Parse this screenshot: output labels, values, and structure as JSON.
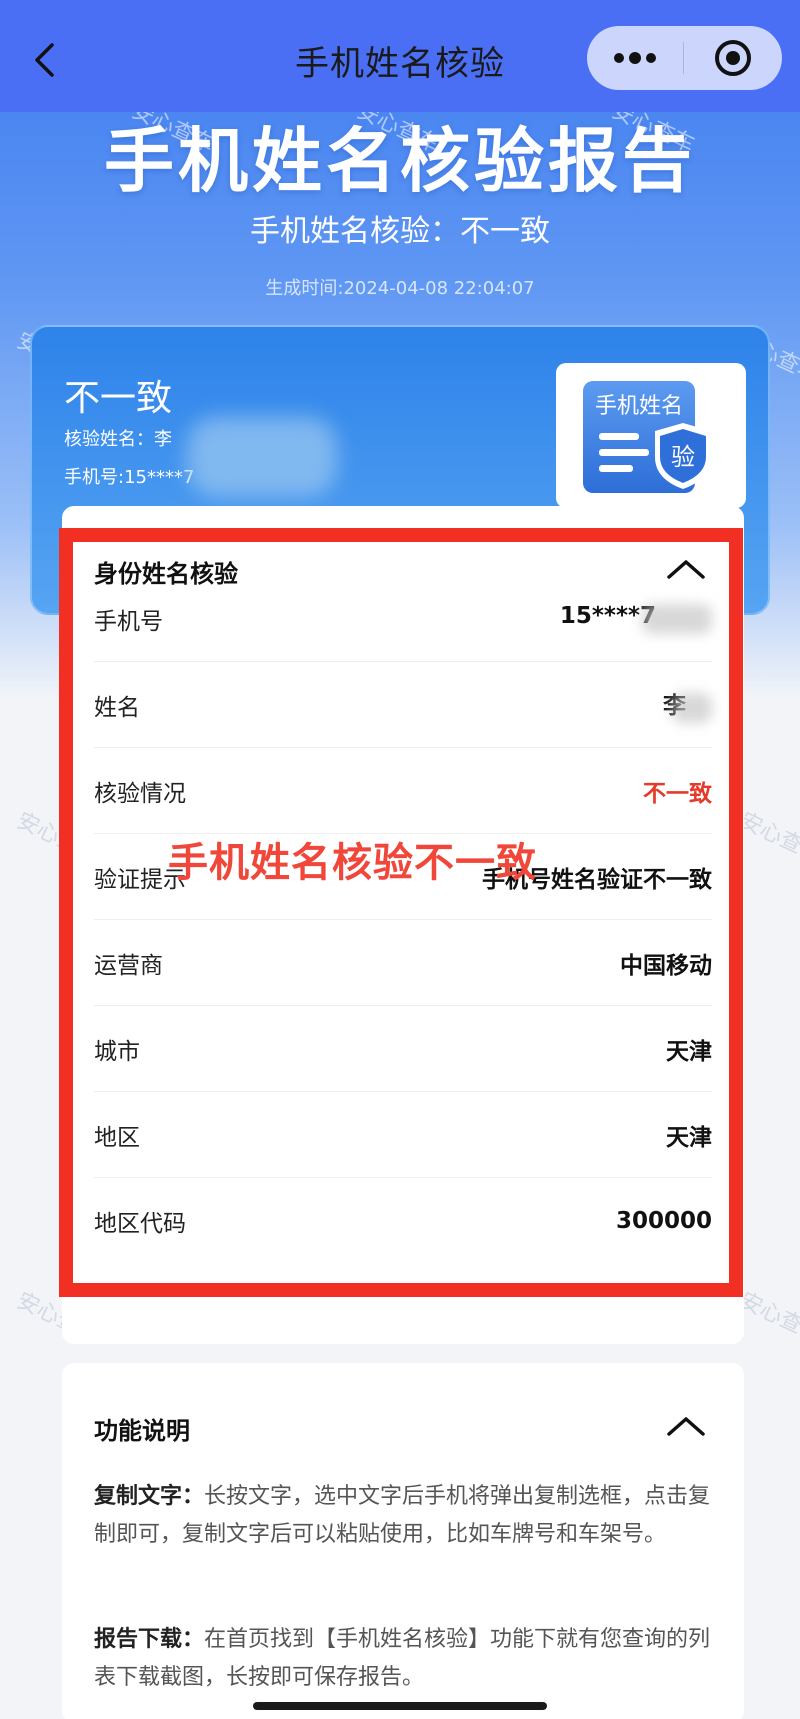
{
  "navbar": {
    "title": "手机姓名核验"
  },
  "watermark": "安心查车",
  "header": {
    "title": "手机姓名核验报告",
    "subtitle": "手机姓名核验：不一致",
    "generated_time": "生成时间:2024-04-08 22:04:07"
  },
  "summary": {
    "status": "不一致",
    "name_line": "核验姓名：李",
    "phone_line": "手机号:15****7",
    "badge_text": "手机姓名",
    "badge_seal": "验"
  },
  "detail": {
    "header": "身份姓名核验",
    "rows": [
      {
        "label": "手机号",
        "value": "15****7"
      },
      {
        "label": "姓名",
        "value": "李"
      },
      {
        "label": "核验情况",
        "value": "不一致"
      },
      {
        "label": "验证提示",
        "value": "手机号姓名验证不一致"
      },
      {
        "label": "运营商",
        "value": "中国移动"
      },
      {
        "label": "城市",
        "value": "天津"
      },
      {
        "label": "地区",
        "value": "天津"
      },
      {
        "label": "地区代码",
        "value": "300000"
      }
    ]
  },
  "annotation": "手机姓名核验不一致",
  "functions": {
    "header": "功能说明",
    "items": [
      {
        "key": "复制文字：",
        "text": "长按文字，选中文字后手机将弹出复制选框，点击复制即可，复制文字后可以粘贴使用，比如车牌号和车架号。"
      },
      {
        "key": "报告下载：",
        "text": "在首页找到【手机姓名核验】功能下就有您查询的列表下载截图，长按即可保存报告。"
      }
    ]
  },
  "colors": {
    "navbar": "#4a6ef4",
    "highlight": "#f13023",
    "mismatch": "#e53a2a"
  }
}
